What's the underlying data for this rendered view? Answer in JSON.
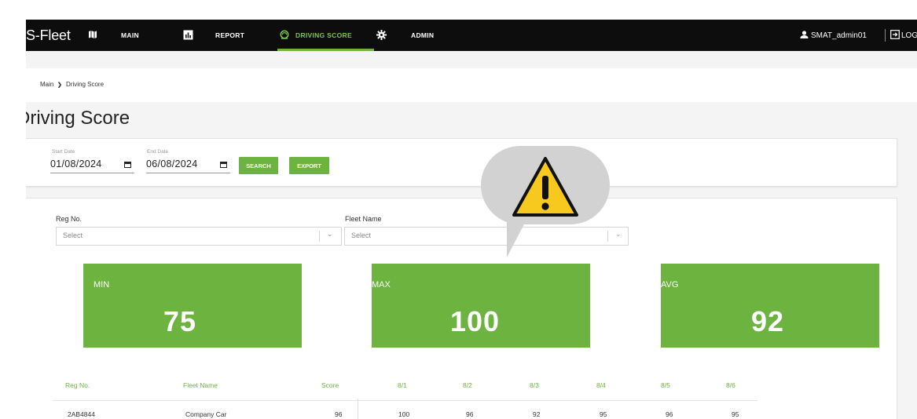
{
  "nav": {
    "brand": "S-Fleet",
    "items": [
      {
        "label": "MAIN",
        "icon": "map-icon",
        "active": false
      },
      {
        "label": "REPORT",
        "icon": "report-icon",
        "active": false
      },
      {
        "label": "DRIVING SCORE",
        "icon": "driving-score-icon",
        "active": true
      },
      {
        "label": "ADMIN",
        "icon": "gear-icon",
        "active": false
      }
    ],
    "user": "SMAT_admin01",
    "logout": "LOG"
  },
  "breadcrumb": {
    "root": "Main",
    "separator": "❯",
    "current": "Driving Score"
  },
  "page_title": "Driving Score",
  "filter": {
    "start_label": "Start Date",
    "start_value": "01/08/2024",
    "end_label": "End Date",
    "end_value": "06/08/2024",
    "search_label": "SEARCH",
    "export_label": "EXPORT"
  },
  "selects": {
    "reg_label": "Reg No.",
    "reg_placeholder": "Select",
    "fleet_label": "Fleet Name",
    "fleet_placeholder": "Select"
  },
  "stats": {
    "min_label": "MIN",
    "min_value": "75",
    "max_label": "MAX",
    "max_value": "100",
    "avg_label": "AVG",
    "avg_value": "92"
  },
  "table": {
    "headers": [
      "Reg No.",
      "Fleet Name",
      "Score",
      "8/1",
      "8/2",
      "8/3",
      "8/4",
      "8/5",
      "8/6"
    ],
    "rows": [
      [
        "2AB4844",
        "Company Car",
        "96",
        "100",
        "96",
        "92",
        "95",
        "96",
        "95"
      ]
    ]
  },
  "colors": {
    "accent": "#6db33f",
    "nav_bg": "#0d0d0d",
    "warning": "#f7c81e"
  }
}
